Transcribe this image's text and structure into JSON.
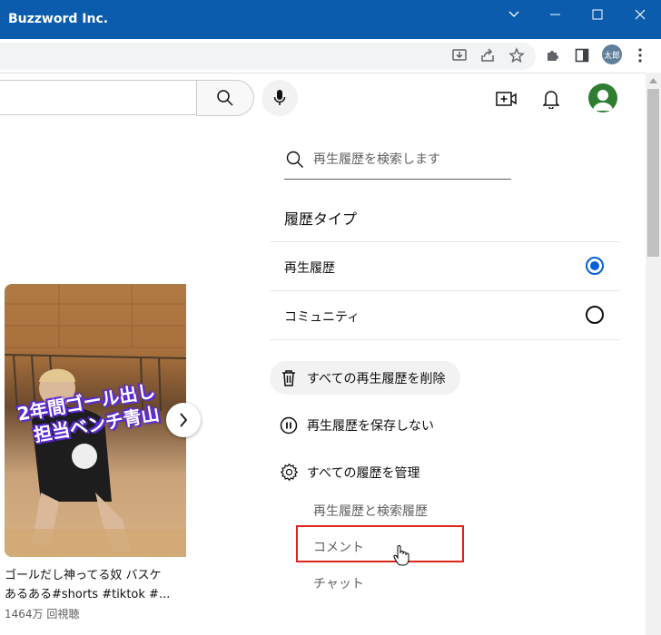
{
  "window": {
    "title": "Buzzword Inc."
  },
  "browser": {
    "profile_label": "太郎"
  },
  "colors": {
    "titlebar": "#0b5cad",
    "accent_blue": "#065fd4",
    "highlight_red": "#e0241a"
  },
  "history_panel": {
    "search_placeholder": "再生履歴を検索します",
    "history_type_title": "履歴タイプ",
    "options": [
      {
        "label": "再生履歴",
        "selected": true
      },
      {
        "label": "コミュニティ",
        "selected": false
      }
    ],
    "actions": {
      "clear_all": "すべての再生履歴を削除",
      "pause": "再生履歴を保存しない",
      "manage_all": "すべての履歴を管理"
    },
    "sub_links": [
      "再生履歴と検索履歴",
      "コメント",
      "チャット"
    ]
  },
  "video": {
    "overlay_line1": "2年間ゴール出し",
    "overlay_line2": "担当ベンチ青山",
    "title_line1": "ゴールだし神ってる奴 バスケ",
    "title_line2": "あるある#shorts #tiktok #...",
    "views": "1464万 回視聴"
  }
}
